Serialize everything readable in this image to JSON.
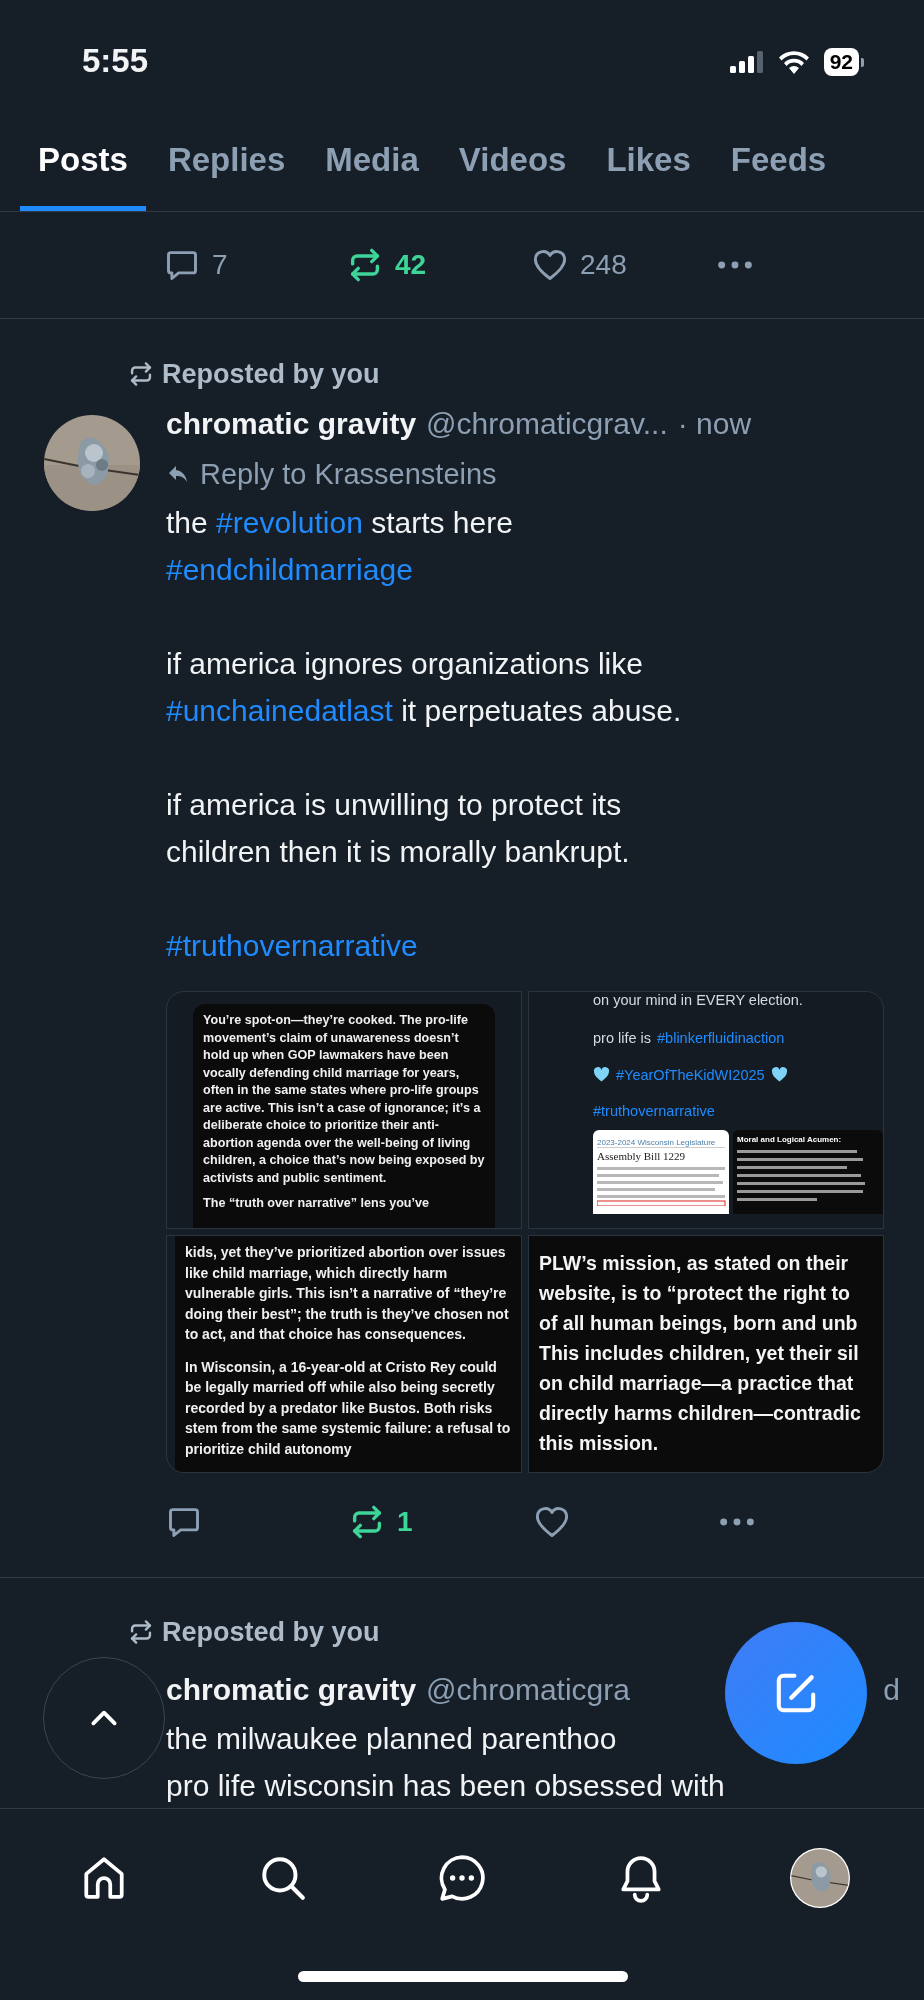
{
  "status_bar": {
    "time": "5:55",
    "battery": "92"
  },
  "tabs": [
    {
      "label": "Posts",
      "selected": true
    },
    {
      "label": "Replies",
      "selected": false
    },
    {
      "label": "Media",
      "selected": false
    },
    {
      "label": "Videos",
      "selected": false
    },
    {
      "label": "Likes",
      "selected": false
    },
    {
      "label": "Feeds",
      "selected": false
    }
  ],
  "posts": [
    {
      "kind": "actions_only",
      "actions": {
        "replies": "7",
        "reposts": "42",
        "reposted": true,
        "likes": "248",
        "liked": false
      }
    },
    {
      "kind": "full",
      "reposted_by": "Reposted by you",
      "author": "chromatic gravity",
      "handle": "@chromaticgrav...",
      "time": "· now",
      "reply_to": "Reply to Krassensteins",
      "paragraphs": [
        [
          [
            {
              "text": "the "
            },
            {
              "text": "#revolution",
              "link": true
            },
            {
              "text": " starts here"
            }
          ],
          [
            {
              "text": "#endchildmarriage",
              "link": true
            }
          ]
        ],
        [
          [
            {
              "text": "if america ignores organizations like"
            }
          ],
          [
            {
              "text": "#unchainedatlast",
              "link": true
            },
            {
              "text": " it perpetuates abuse."
            }
          ]
        ],
        [
          [
            {
              "text": "if america is unwilling to protect its"
            }
          ],
          [
            {
              "text": "children then it is morally bankrupt."
            }
          ]
        ],
        [
          [
            {
              "text": "#truthovernarrative",
              "link": true
            }
          ]
        ]
      ],
      "images": [
        {
          "kind": "text_box",
          "paragraphs": [
            "You’re spot-on—they’re cooked. The pro-life movement’s claim of unawareness doesn’t hold up when GOP lawmakers have been vocally defending child marriage for years, often in the same states where pro-life groups are active. This isn’t a case of ignorance; it’s a deliberate choice to prioritize their anti-abortion agenda over the well-being of living children, a choice that’s now being exposed by activists and public sentiment.",
            "The “truth over narrative” lens you’ve"
          ]
        },
        {
          "kind": "nested_post",
          "lines": [
            [
              {
                "text": "on your mind in EVERY election."
              }
            ],
            [
              {
                "text": "pro life is "
              },
              {
                "text": "#blinkerfluidinaction",
                "link": true
              }
            ],
            [
              {
                "text": "#YearOfTheKidWI2025",
                "link": true,
                "hearts": true
              }
            ],
            [
              {
                "text": "#truthovernarrative",
                "link": true
              }
            ]
          ],
          "document": {
            "header": "2023-2024 Wisconsin Legislature",
            "title": "Assembly Bill 1229"
          },
          "bullet": {
            "title": "Moral and Logical Acumen:"
          }
        },
        {
          "kind": "text_box",
          "paragraphs": [
            "kids, yet they’ve prioritized abortion over issues like child marriage, which directly harm vulnerable girls. This isn’t a narrative of “they’re doing their best”; the truth is they’ve chosen not to act, and that choice has consequences.",
            "In Wisconsin, a 16-year-old at Cristo Rey could be legally married off while also being secretly recorded by a predator like Bustos. Both risks stem from the same systemic failure: a refusal to prioritize child autonomy"
          ]
        },
        {
          "kind": "cropped_lines",
          "lines": [
            "PLW’s mission, as stated on their",
            "website, is to “protect the right to",
            "of all human beings, born and unb",
            "This includes children, yet their sil",
            "on child marriage—a practice that",
            "directly harms children—contradic",
            "this mission."
          ]
        }
      ],
      "actions": {
        "reposts": "1",
        "reposted": true,
        "liked": false
      }
    },
    {
      "kind": "partial",
      "reposted_by": "Reposted by you",
      "author": "chromatic gravity",
      "handle": "@chromaticgra",
      "time": "d",
      "lines": [
        "the milwaukee planned parenthoo",
        "pro life wisconsin has been obsessed with"
      ]
    }
  ]
}
